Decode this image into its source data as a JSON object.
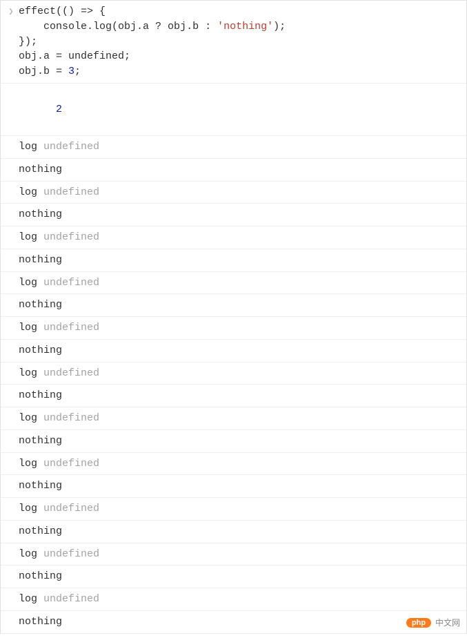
{
  "input": {
    "line1_a": "effect",
    "line1_b": "(() => {",
    "line2_a": "    console.",
    "line2_b": "log",
    "line2_c": "(obj.a ? obj.b : ",
    "line2_str": "'nothing'",
    "line2_d": ");",
    "line3": "});",
    "line4_a": "obj.a = ",
    "line4_b": "undefined",
    "line4_c": ";",
    "line5_a": "obj.b = ",
    "line5_num": "3",
    "line5_b": ";"
  },
  "result": {
    "value": "2"
  },
  "log_entry": {
    "label": "log",
    "value": " undefined"
  },
  "msg": {
    "text": "nothing"
  },
  "repeat_count": 11,
  "watermark": {
    "pill": "php",
    "text": "中文网"
  }
}
